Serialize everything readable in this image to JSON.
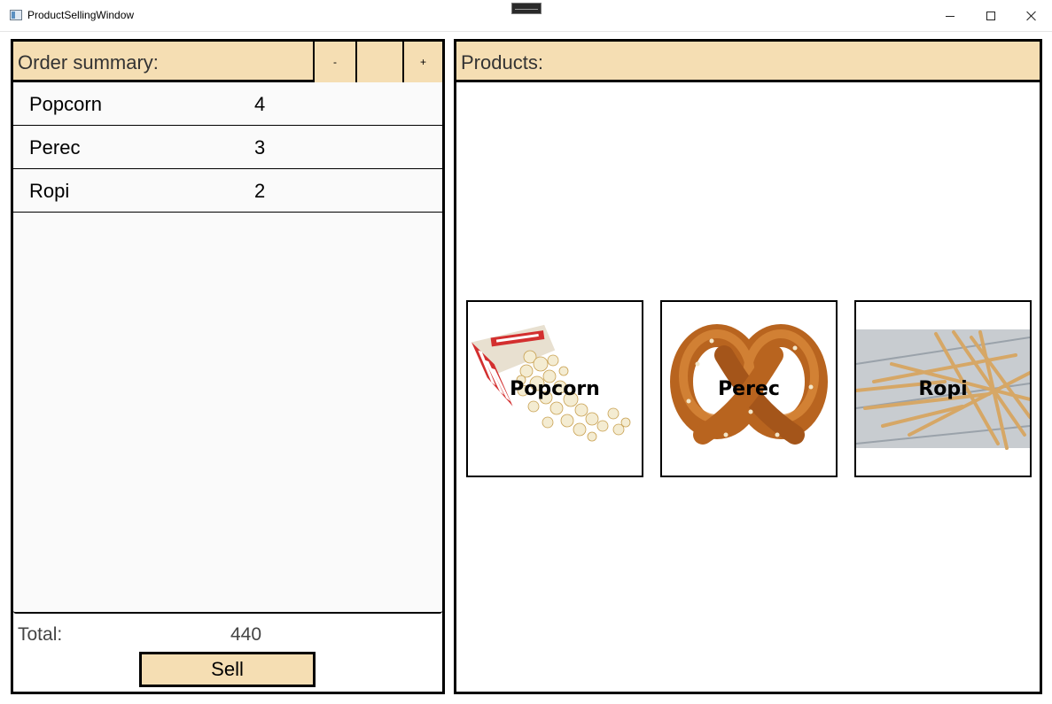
{
  "window": {
    "title": "ProductSellingWindow",
    "minimize_icon": "minimize-icon",
    "maximize_icon": "maximize-icon",
    "close_icon": "close-icon"
  },
  "order": {
    "title": "Order summary:",
    "minus_label": "-",
    "middle_label": "",
    "plus_label": "+",
    "items": [
      {
        "name": "Popcorn",
        "qty": "4"
      },
      {
        "name": "Perec",
        "qty": "3"
      },
      {
        "name": "Ropi",
        "qty": "2"
      }
    ],
    "total_label": "Total:",
    "total_value": "440",
    "sell_label": "Sell"
  },
  "products": {
    "title": "Products:",
    "items": [
      {
        "name": "Popcorn",
        "image": "popcorn-image"
      },
      {
        "name": "Perec",
        "image": "pretzel-image"
      },
      {
        "name": "Ropi",
        "image": "breadsticks-image"
      }
    ]
  },
  "colors": {
    "accent": "#f5deb3",
    "border": "#000000",
    "list_bg": "#fafafa"
  }
}
